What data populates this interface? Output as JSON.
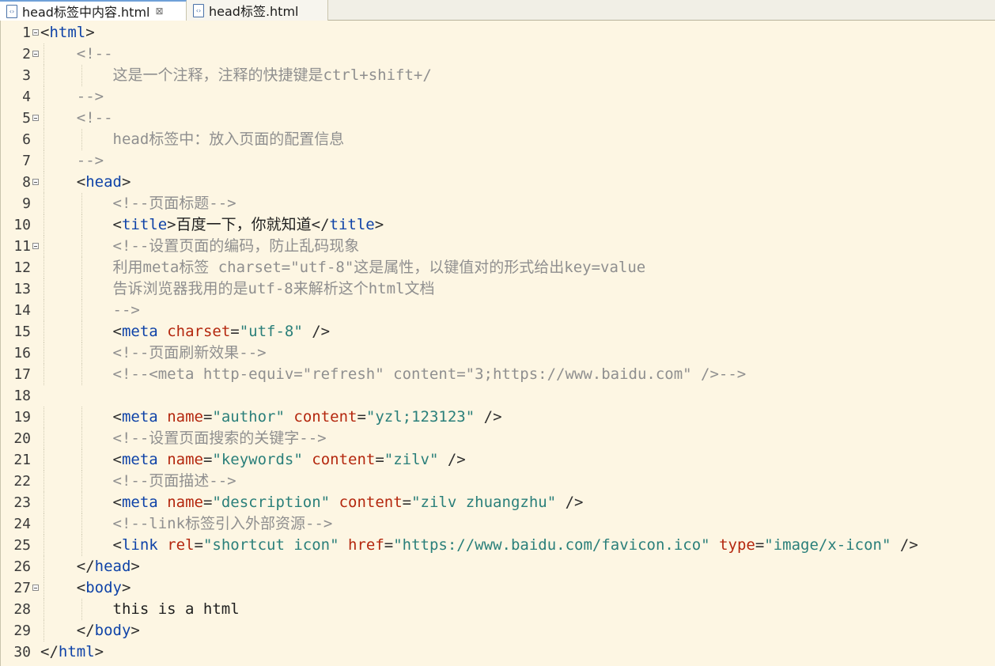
{
  "tabs": [
    {
      "label": "head标签中内容.html",
      "active": true,
      "close": "⊠"
    },
    {
      "label": "head标签.html",
      "active": false
    }
  ],
  "lines": [
    {
      "num": "1",
      "fold": true,
      "indent": 0,
      "tokens": [
        [
          "tg",
          "<"
        ],
        [
          "tn",
          "html"
        ],
        [
          "tg",
          ">"
        ]
      ]
    },
    {
      "num": "2",
      "fold": true,
      "indent": 1,
      "tokens": [
        [
          "cm",
          "<!--"
        ]
      ]
    },
    {
      "num": "3",
      "fold": false,
      "indent": 2,
      "tokens": [
        [
          "cm",
          "这是一个注释，注释的快捷键是ctrl+shift+/"
        ]
      ]
    },
    {
      "num": "4",
      "fold": false,
      "indent": 1,
      "tokens": [
        [
          "cm",
          "-->"
        ]
      ]
    },
    {
      "num": "5",
      "fold": true,
      "indent": 1,
      "tokens": [
        [
          "cm",
          "<!--"
        ]
      ]
    },
    {
      "num": "6",
      "fold": false,
      "indent": 2,
      "tokens": [
        [
          "cm",
          "head标签中：放入页面的配置信息"
        ]
      ]
    },
    {
      "num": "7",
      "fold": false,
      "indent": 1,
      "tokens": [
        [
          "cm",
          "-->"
        ]
      ]
    },
    {
      "num": "8",
      "fold": true,
      "indent": 1,
      "tokens": [
        [
          "tg",
          "<"
        ],
        [
          "tn",
          "head"
        ],
        [
          "tg",
          ">"
        ]
      ]
    },
    {
      "num": "9",
      "fold": false,
      "indent": 2,
      "tokens": [
        [
          "cm",
          "<!--页面标题-->"
        ]
      ]
    },
    {
      "num": "10",
      "fold": false,
      "indent": 2,
      "tokens": [
        [
          "tg",
          "<"
        ],
        [
          "tn",
          "title"
        ],
        [
          "tg",
          ">"
        ],
        [
          "tx",
          "百度一下，你就知道"
        ],
        [
          "tg",
          "</"
        ],
        [
          "tn",
          "title"
        ],
        [
          "tg",
          ">"
        ]
      ]
    },
    {
      "num": "11",
      "fold": true,
      "indent": 2,
      "tokens": [
        [
          "cm",
          "<!--设置页面的编码，防止乱码现象"
        ]
      ]
    },
    {
      "num": "12",
      "fold": false,
      "indent": 2,
      "tokens": [
        [
          "cm",
          "利用meta标签 charset=\"utf-8\"这是属性，以键值对的形式给出key=value"
        ]
      ]
    },
    {
      "num": "13",
      "fold": false,
      "indent": 2,
      "tokens": [
        [
          "cm",
          "告诉浏览器我用的是utf-8来解析这个html文档"
        ]
      ]
    },
    {
      "num": "14",
      "fold": false,
      "indent": 2,
      "tokens": [
        [
          "cm",
          "-->"
        ]
      ]
    },
    {
      "num": "15",
      "fold": false,
      "indent": 2,
      "tokens": [
        [
          "tg",
          "<"
        ],
        [
          "tn",
          "meta"
        ],
        [
          "tx",
          " "
        ],
        [
          "an",
          "charset"
        ],
        [
          "tg",
          "="
        ],
        [
          "av",
          "\"utf-8\""
        ],
        [
          "tg",
          " />"
        ]
      ]
    },
    {
      "num": "16",
      "fold": false,
      "indent": 2,
      "tokens": [
        [
          "cm",
          "<!--页面刷新效果-->"
        ]
      ]
    },
    {
      "num": "17",
      "fold": false,
      "indent": 2,
      "tokens": [
        [
          "cm",
          "<!--<meta http-equiv=\"refresh\" content=\"3;https://www.baidu.com\" />-->"
        ]
      ]
    },
    {
      "num": "18",
      "fold": false,
      "indent": 0,
      "tokens": []
    },
    {
      "num": "19",
      "fold": false,
      "indent": 2,
      "tokens": [
        [
          "tg",
          "<"
        ],
        [
          "tn",
          "meta"
        ],
        [
          "tx",
          " "
        ],
        [
          "an",
          "name"
        ],
        [
          "tg",
          "="
        ],
        [
          "av",
          "\"author\""
        ],
        [
          "tx",
          " "
        ],
        [
          "an",
          "content"
        ],
        [
          "tg",
          "="
        ],
        [
          "av",
          "\"yzl;123123\""
        ],
        [
          "tg",
          " />"
        ]
      ]
    },
    {
      "num": "20",
      "fold": false,
      "indent": 2,
      "tokens": [
        [
          "cm",
          "<!--设置页面搜索的关键字-->"
        ]
      ]
    },
    {
      "num": "21",
      "fold": false,
      "indent": 2,
      "tokens": [
        [
          "tg",
          "<"
        ],
        [
          "tn",
          "meta"
        ],
        [
          "tx",
          " "
        ],
        [
          "an",
          "name"
        ],
        [
          "tg",
          "="
        ],
        [
          "av",
          "\"keywords\""
        ],
        [
          "tx",
          " "
        ],
        [
          "an",
          "content"
        ],
        [
          "tg",
          "="
        ],
        [
          "av",
          "\"zilv\""
        ],
        [
          "tg",
          " />"
        ]
      ]
    },
    {
      "num": "22",
      "fold": false,
      "indent": 2,
      "tokens": [
        [
          "cm",
          "<!--页面描述-->"
        ]
      ]
    },
    {
      "num": "23",
      "fold": false,
      "indent": 2,
      "tokens": [
        [
          "tg",
          "<"
        ],
        [
          "tn",
          "meta"
        ],
        [
          "tx",
          " "
        ],
        [
          "an",
          "name"
        ],
        [
          "tg",
          "="
        ],
        [
          "av",
          "\"description\""
        ],
        [
          "tx",
          " "
        ],
        [
          "an",
          "content"
        ],
        [
          "tg",
          "="
        ],
        [
          "av",
          "\"zilv zhuangzhu\""
        ],
        [
          "tg",
          " />"
        ]
      ]
    },
    {
      "num": "24",
      "fold": false,
      "indent": 2,
      "tokens": [
        [
          "cm",
          "<!--link标签引入外部资源-->"
        ]
      ]
    },
    {
      "num": "25",
      "fold": false,
      "indent": 2,
      "tokens": [
        [
          "tg",
          "<"
        ],
        [
          "tn",
          "link"
        ],
        [
          "tx",
          " "
        ],
        [
          "an",
          "rel"
        ],
        [
          "tg",
          "="
        ],
        [
          "av",
          "\"shortcut icon\""
        ],
        [
          "tx",
          " "
        ],
        [
          "an",
          "href"
        ],
        [
          "tg",
          "="
        ],
        [
          "av",
          "\"https://www.baidu.com/favicon.ico\""
        ],
        [
          "tx",
          " "
        ],
        [
          "an",
          "type"
        ],
        [
          "tg",
          "="
        ],
        [
          "av",
          "\"image/x-icon\""
        ],
        [
          "tg",
          " />"
        ]
      ]
    },
    {
      "num": "26",
      "fold": false,
      "indent": 1,
      "tokens": [
        [
          "tg",
          "</"
        ],
        [
          "tn",
          "head"
        ],
        [
          "tg",
          ">"
        ]
      ]
    },
    {
      "num": "27",
      "fold": true,
      "indent": 1,
      "tokens": [
        [
          "tg",
          "<"
        ],
        [
          "tn",
          "body"
        ],
        [
          "tg",
          ">"
        ]
      ]
    },
    {
      "num": "28",
      "fold": false,
      "indent": 2,
      "tokens": [
        [
          "tx",
          "this is a html"
        ]
      ]
    },
    {
      "num": "29",
      "fold": false,
      "indent": 1,
      "tokens": [
        [
          "tg",
          "</"
        ],
        [
          "tn",
          "body"
        ],
        [
          "tg",
          ">"
        ]
      ]
    },
    {
      "num": "30",
      "fold": false,
      "indent": 0,
      "tokens": [
        [
          "tg",
          "</"
        ],
        [
          "tn",
          "html"
        ],
        [
          "tg",
          ">"
        ]
      ]
    }
  ]
}
